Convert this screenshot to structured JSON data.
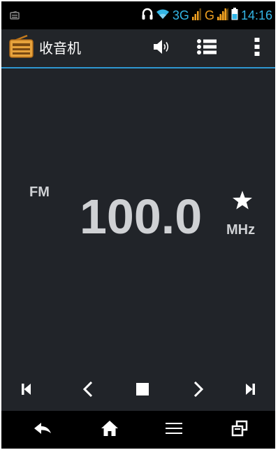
{
  "status_bar": {
    "network_3g": "3G",
    "network_g": "G",
    "time": "14:16",
    "time_color": "#33b5e5",
    "signal_color": "#f0a020"
  },
  "action_bar": {
    "title": "收音机",
    "accent_color": "#2e97d0"
  },
  "tuner": {
    "band": "FM",
    "frequency": "100.0",
    "unit": "MHz"
  },
  "controls": [
    "skip-to-start-icon",
    "previous-icon",
    "stop-icon",
    "next-icon",
    "skip-to-end-icon"
  ],
  "nav_bar": [
    "back-icon",
    "home-icon",
    "menu-icon",
    "recent-apps-icon"
  ]
}
